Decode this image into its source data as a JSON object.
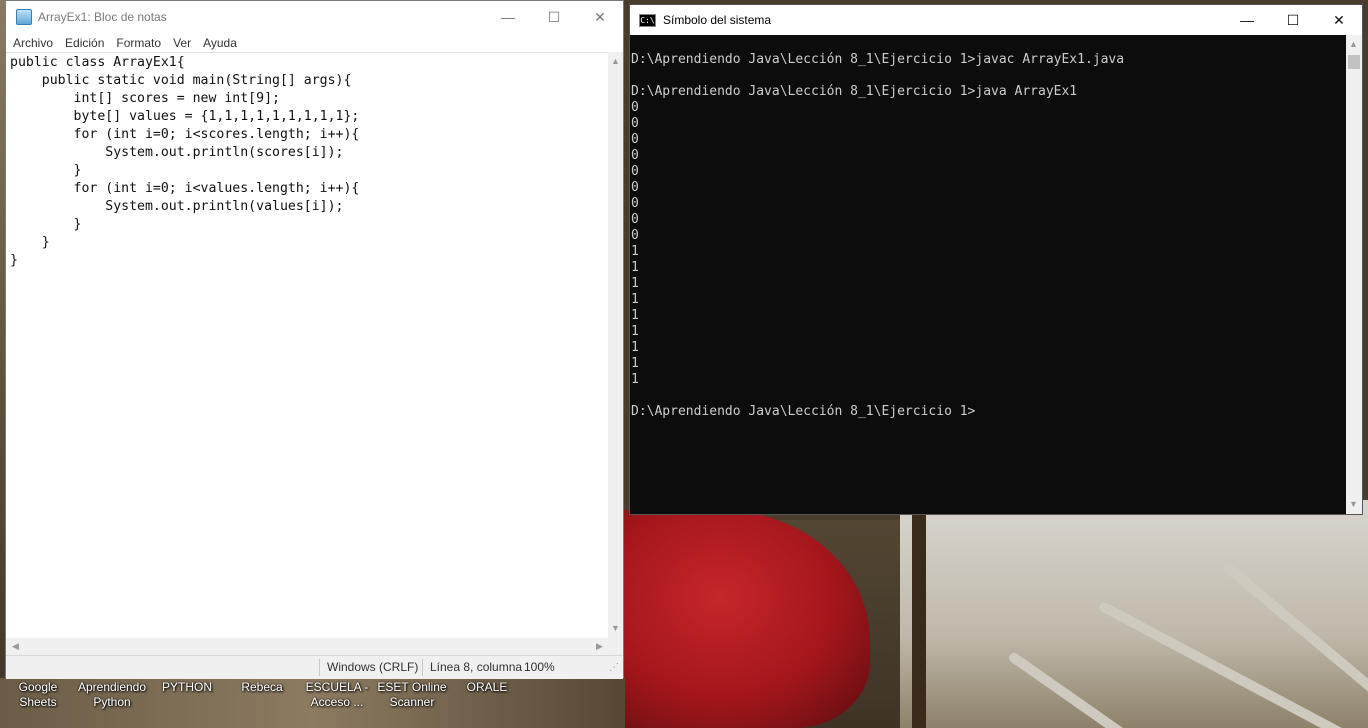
{
  "notepad": {
    "title": "ArrayEx1: Bloc de notas",
    "window_buttons": {
      "minimize": "—",
      "maximize": "☐",
      "close": "✕"
    },
    "menu": [
      "Archivo",
      "Edición",
      "Formato",
      "Ver",
      "Ayuda"
    ],
    "content": "public class ArrayEx1{\n    public static void main(String[] args){\n        int[] scores = new int[9];\n        byte[] values = {1,1,1,1,1,1,1,1,1};\n        for (int i=0; i<scores.length; i++){\n            System.out.println(scores[i]);\n        }\n        for (int i=0; i<values.length; i++){\n            System.out.println(values[i]);\n        }\n    }\n}",
    "status": {
      "encoding": "Windows (CRLF)",
      "position": "Línea 8, columna",
      "zoom": "100%"
    }
  },
  "cmd": {
    "title": "Símbolo del sistema",
    "icon_text": "C:\\",
    "window_buttons": {
      "minimize": "—",
      "maximize": "☐",
      "close": "✕"
    },
    "output": "D:\\Aprendiendo Java\\Lección 8_1\\Ejercicio 1>javac ArrayEx1.java\n\nD:\\Aprendiendo Java\\Lección 8_1\\Ejercicio 1>java ArrayEx1\n0\n0\n0\n0\n0\n0\n0\n0\n0\n1\n1\n1\n1\n1\n1\n1\n1\n1\n\nD:\\Aprendiendo Java\\Lección 8_1\\Ejercicio 1>"
  },
  "desktop_icons": [
    {
      "label": "Google\nSheets"
    },
    {
      "label": "Aprendiendo\nPython"
    },
    {
      "label": "PYTHON"
    },
    {
      "label": "Rebeca"
    },
    {
      "label": "ESCUELA -\nAcceso ..."
    },
    {
      "label": "ESET Online\nScanner"
    },
    {
      "label": "ORALE"
    }
  ]
}
